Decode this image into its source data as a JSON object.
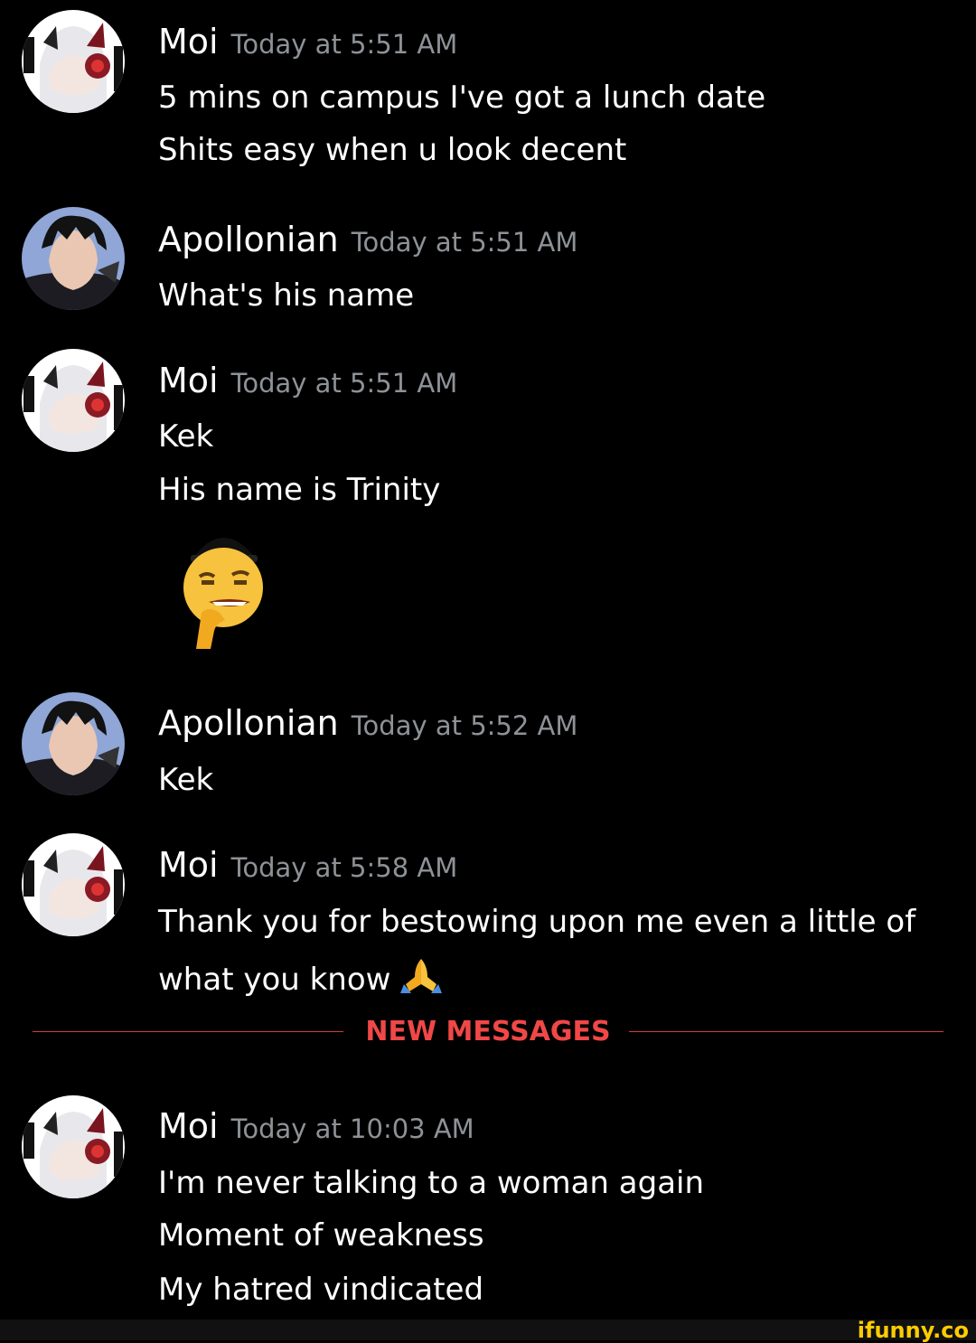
{
  "messages": [
    {
      "avatar": "moi-avatar",
      "username": "Moi",
      "timestamp": "Today at 5:51 AM",
      "lines": [
        "5 mins on campus I've got a lunch date",
        "Shits easy when u look decent"
      ]
    },
    {
      "avatar": "apollonian-avatar",
      "username": "Apollonian",
      "timestamp": "Today at 5:51 AM",
      "lines": [
        "What's his name"
      ]
    },
    {
      "avatar": "moi-avatar",
      "username": "Moi",
      "timestamp": "Today at 5:51 AM",
      "lines": [
        "Kek",
        "His name is Trinity"
      ],
      "emoji": "thinking-face-with-cap-emoji"
    },
    {
      "avatar": "apollonian-avatar",
      "username": "Apollonian",
      "timestamp": "Today at 5:52 AM",
      "lines": [
        "Kek"
      ]
    },
    {
      "avatar": "moi-avatar",
      "username": "Moi",
      "timestamp": "Today at 5:58 AM",
      "lines": [
        "Thank you for bestowing upon me even a little of",
        "what you know"
      ],
      "inline_emoji": "folded-hands-emoji"
    },
    {
      "avatar": "moi-avatar",
      "username": "Moi",
      "timestamp": "Today at 10:03 AM",
      "lines": [
        "I'm never talking to a woman again",
        "Moment of weakness",
        "My hatred vindicated"
      ]
    }
  ],
  "divider": {
    "label": "NEW MESSAGES"
  },
  "watermark": "ifunny.co",
  "colors": {
    "background": "#000000",
    "timestamp": "#8e9297",
    "new_messages": "#f04747"
  }
}
